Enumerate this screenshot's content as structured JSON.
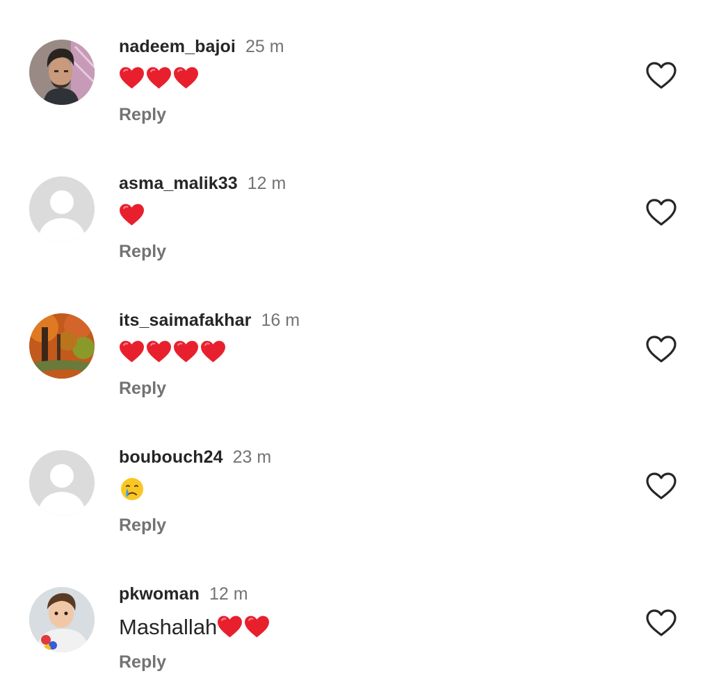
{
  "comments": [
    {
      "username": "nadeem_bajoi",
      "time": "25 m",
      "text": "",
      "hearts": 3,
      "emoji": "",
      "reply_label": "Reply",
      "avatar": "photo-man"
    },
    {
      "username": "asma_malik33",
      "time": "12 m",
      "text": "",
      "hearts": 1,
      "emoji": "",
      "reply_label": "Reply",
      "avatar": "default"
    },
    {
      "username": "its_saimafakhar",
      "time": "16 m",
      "text": "",
      "hearts": 4,
      "emoji": "",
      "reply_label": "Reply",
      "avatar": "photo-autumn"
    },
    {
      "username": "boubouch24",
      "time": "23 m",
      "text": "",
      "hearts": 0,
      "emoji": "crying-face",
      "reply_label": "Reply",
      "avatar": "default"
    },
    {
      "username": "pkwoman",
      "time": "12 m",
      "text": "Mashallah",
      "hearts": 2,
      "emoji": "",
      "reply_label": "Reply",
      "avatar": "photo-child"
    }
  ],
  "colors": {
    "heart_emoji": "#e8202e",
    "secondary_text": "#737373",
    "primary_text": "#262626",
    "like_outline": "#262626"
  }
}
